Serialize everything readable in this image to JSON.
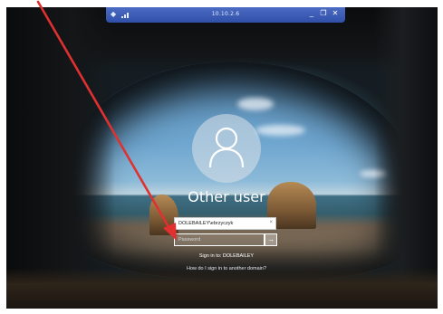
{
  "rdp_bar": {
    "title": "10.10.2.6",
    "pin_icon": "pin-icon",
    "signal_icon": "signal-bars-icon",
    "minimize": "_",
    "restore": "Ɖ",
    "close": "✕"
  },
  "login": {
    "avatar_icon": "user-silhouette-icon",
    "username": "Other user",
    "user_field_value": "DOLEBAILEY\\ebrzyczyk",
    "user_field_clear": "×",
    "password_placeholder": "Password",
    "submit_icon": "→",
    "sign_in_to": "Sign in to: DOLEBAILEY",
    "other_domain_link": "How do I sign in to another domain?"
  },
  "annotation": {
    "arrow_color": "#e03030"
  }
}
